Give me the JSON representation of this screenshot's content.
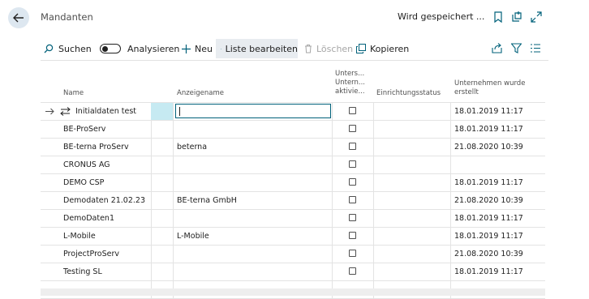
{
  "header": {
    "title": "Mandanten",
    "save_status": "Wird gespeichert ..."
  },
  "toolbar": {
    "search": "Suchen",
    "analyze": "Analysieren",
    "new": "Neu",
    "edit_list": "Liste bearbeiten",
    "delete": "Löschen",
    "copy": "Kopieren"
  },
  "columns": {
    "name": "Name",
    "display_name": "Anzeigename",
    "evaluation_line1": "Unters...",
    "evaluation_line2": "Untern...",
    "evaluation_line3": "aktivie...",
    "setup_status": "Einrichtungsstatus",
    "created_line1": "Unternehmen wurde",
    "created_line2": "erstellt"
  },
  "rows": [
    {
      "name": "Initialdaten test",
      "display": "",
      "evaluation": false,
      "status": "",
      "created": "18.01.2019 11:17"
    },
    {
      "name": "BE-ProServ",
      "display": "",
      "evaluation": false,
      "status": "",
      "created": "18.01.2019 11:17"
    },
    {
      "name": "BE-terna ProServ",
      "display": "beterna",
      "evaluation": false,
      "status": "",
      "created": "21.08.2020 10:39"
    },
    {
      "name": "CRONUS AG",
      "display": "",
      "evaluation": false,
      "status": "",
      "created": ""
    },
    {
      "name": "DEMO CSP",
      "display": "",
      "evaluation": false,
      "status": "",
      "created": "18.01.2019 11:17"
    },
    {
      "name": "Demodaten 21.02.23",
      "display": "BE-terna GmbH",
      "evaluation": false,
      "status": "",
      "created": "21.08.2020 10:39"
    },
    {
      "name": "DemoDaten1",
      "display": "",
      "evaluation": false,
      "status": "",
      "created": "18.01.2019 11:17"
    },
    {
      "name": "L-Mobile",
      "display": "L-Mobile",
      "evaluation": false,
      "status": "",
      "created": "18.01.2019 11:17"
    },
    {
      "name": "ProjectProServ",
      "display": "",
      "evaluation": false,
      "status": "",
      "created": "21.08.2020 10:39"
    },
    {
      "name": "Testing SL",
      "display": "",
      "evaluation": false,
      "status": "",
      "created": "18.01.2019 11:17"
    },
    {
      "name": "",
      "display": "",
      "evaluation": null,
      "status": "",
      "created": ""
    }
  ],
  "colors": {
    "accent": "#00617a",
    "selection": "#c6eaf2",
    "back_button": "#dde7f0"
  },
  "icons": {
    "back": "arrow-left-icon",
    "bookmark": "bookmark-icon",
    "open_new": "open-in-new-window-icon",
    "expand": "expand-icon",
    "search": "search-icon",
    "new": "plus-icon",
    "edit_list": "edit-list-icon",
    "delete": "trash-icon",
    "copy": "copy-icon",
    "share": "share-icon",
    "filter": "filter-icon",
    "list_view": "list-view-icon",
    "row_arrow": "arrow-right-icon",
    "row_swap": "swap-arrows-icon"
  }
}
